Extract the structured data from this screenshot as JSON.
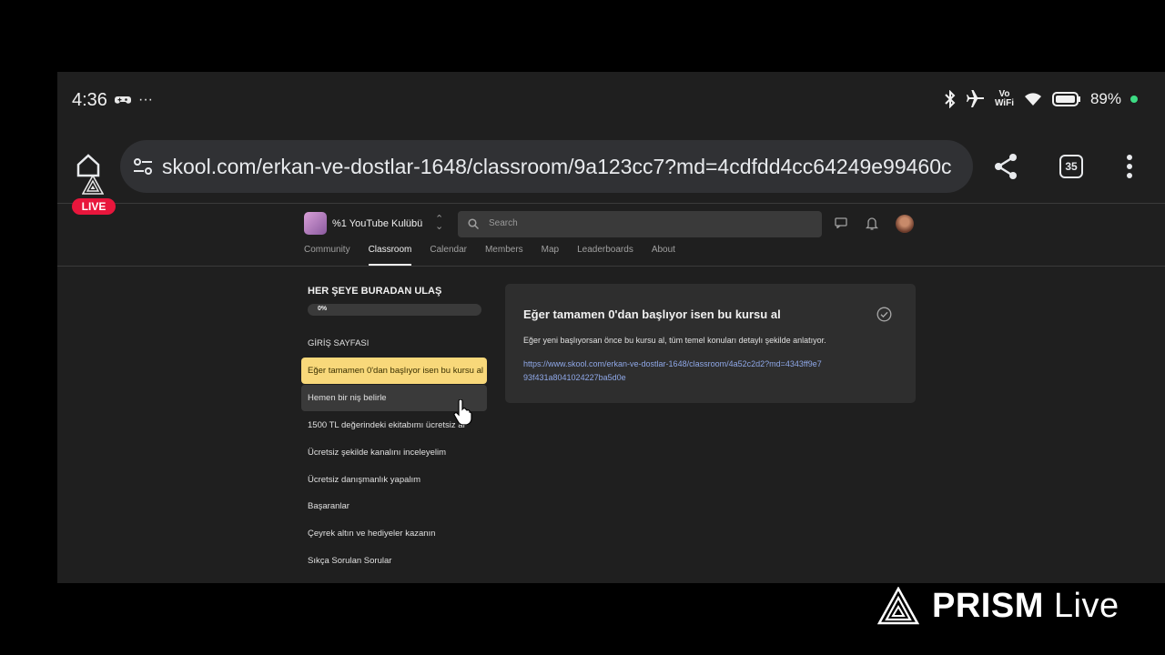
{
  "status_bar": {
    "time": "4:36",
    "ellipsis": "···",
    "battery": "89%"
  },
  "browser": {
    "url": "skool.com/erkan-ve-dostlar-1648/classroom/9a123cc7?md=4cdfdd4cc64249e99460c",
    "tab_count": "35"
  },
  "site": {
    "group_name": "%1 YouTube Kulübü",
    "search_placeholder": "Search",
    "nav": [
      "Community",
      "Classroom",
      "Calendar",
      "Members",
      "Map",
      "Leaderboards",
      "About"
    ],
    "active_nav": "Classroom"
  },
  "course": {
    "title": "HER ŞEYE BURADAN ULAŞ",
    "progress_label": "0%",
    "progress": 0,
    "section_title": "GİRİŞ SAYFASI",
    "lessons": [
      "Eğer tamamen 0'dan başlıyor isen bu kursu al",
      "Hemen bir niş belirle",
      "1500 TL değerindeki ekitabımı ücretsiz al",
      "Ücretsiz şekilde kanalını inceleyelim",
      "Ücretsiz danışmanlık yapalım",
      "Başaranlar",
      "Çeyrek altın ve hediyeler kazanın",
      "Sıkça Sorulan Sorular"
    ]
  },
  "lesson_detail": {
    "title": "Eğer tamamen 0'dan başlıyor isen bu kursu al",
    "description": "Eğer yeni başlıyorsan önce bu kursu al, tüm temel konuları detaylı şekilde anlatıyor.",
    "link": "https://www.skool.com/erkan-ve-dostlar-1648/classroom/4a52c2d2?md=4343ff9e793f431a8041024227ba5d0e"
  },
  "overlay": {
    "live_badge": "LIVE",
    "brand_bold": "PRISM",
    "brand_light": " Live"
  },
  "colors": {
    "active_lesson": "#f8d87a",
    "live_red": "#e8163c",
    "link": "#8fa8e8"
  }
}
